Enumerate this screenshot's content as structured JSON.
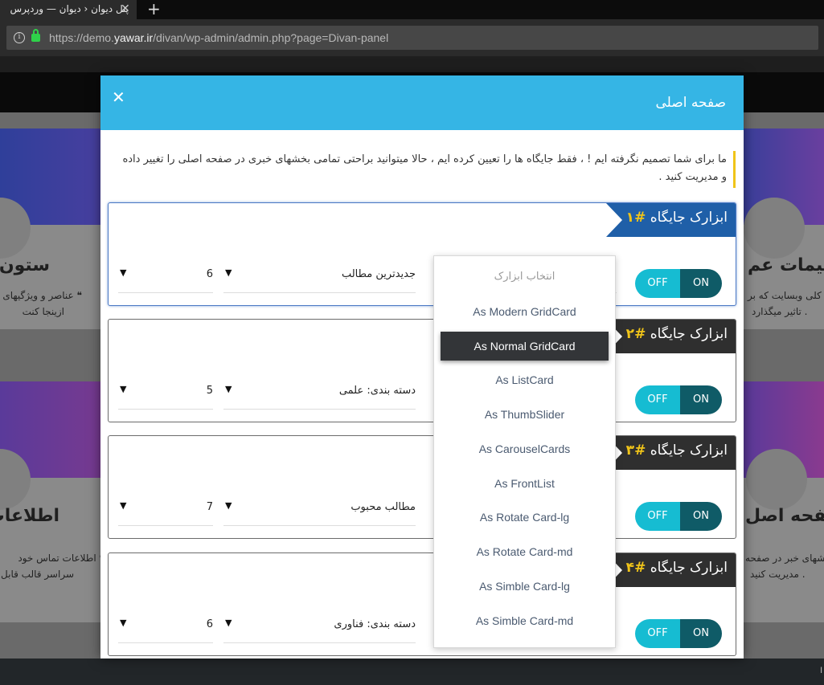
{
  "browser": {
    "tab_title": "پنل دیوان ‹ دیوان — وردپرس",
    "tab_close": "✕",
    "new_tab": "+",
    "url_prefix": "https://demo.",
    "url_domain": "yawar.ir",
    "url_path": "/divan/wp-admin/admin.php?page=Divan-panel"
  },
  "background": {
    "cards": [
      {
        "title": "ستون",
        "desc_line1": "عناصر و ویژگیهای م",
        "desc_line2": "ازینجا کنت"
      },
      {
        "title": "ظیمات عم",
        "desc_line1": "کلی وبسایت که بر",
        "desc_line2": "تاثیر میگذارد ."
      },
      {
        "title": "اطلاعات",
        "desc_line1": "اطلاعات تماس خود",
        "desc_line2": "سراسر قالب قابل د"
      },
      {
        "title": "صفحه اصل",
        "desc_line1": "بخشهای خبر در صفحه",
        "desc_line2": "مدیریت کنید ."
      }
    ],
    "quote_mark": "❝",
    "footer_char": "ا"
  },
  "modal": {
    "title": "صفحه اصلی",
    "close": "✕",
    "notice": "ما برای شما تصمیم نگرفته ایم ! ، فقط جایگاه ها را تعیین کرده ایم ، حالا میتوانید براحتی تمامی بخشهای خبری در صفحه اصلی را تغییر داده و مدیریت کنید ."
  },
  "slots": [
    {
      "badge": "ابزارک جایگاه",
      "num": "#۱",
      "type": "جدیدترین مطالب",
      "count": "6",
      "off": "OFF",
      "on": "ON"
    },
    {
      "badge": "ابزارک جایگاه",
      "num": "#۲",
      "type": "دسته بندی: علمی",
      "count": "5",
      "off": "OFF",
      "on": "ON"
    },
    {
      "badge": "ابزارک جایگاه",
      "num": "#۳",
      "type": "مطالب محبوب",
      "count": "7",
      "off": "OFF",
      "on": "ON"
    },
    {
      "badge": "ابزارک جایگاه",
      "num": "#۴",
      "type": "دسته بندی: فناوری",
      "count": "6",
      "off": "OFF",
      "on": "ON"
    }
  ],
  "select_arrow": "▼",
  "dropdown": {
    "placeholder": "انتخاب ابزارک",
    "items": [
      "As Modern GridCard",
      "As Normal GridCard",
      "As ListCard",
      "As ThumbSlider",
      "As CarouselCards",
      "As FrontList",
      "As Rotate Card-lg",
      "As Rotate Card-md",
      "As Simble Card-lg",
      "As Simble Card-md"
    ],
    "selected": "As Normal GridCard"
  }
}
